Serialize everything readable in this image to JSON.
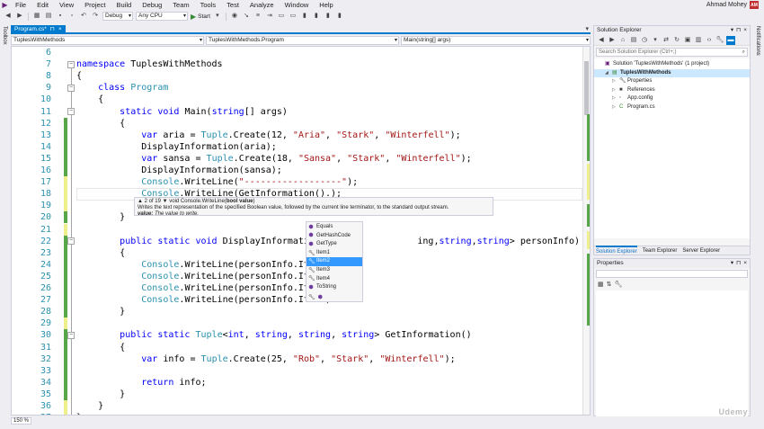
{
  "menu": {
    "items": [
      "File",
      "Edit",
      "View",
      "Project",
      "Build",
      "Debug",
      "Team",
      "Tools",
      "Test",
      "Analyze",
      "Window",
      "Help"
    ],
    "account_name": "Ahmad Mohey",
    "avatar_initials": "AM"
  },
  "toolbar": {
    "config": "Debug",
    "platform": "Any CPU",
    "start_label": "Start"
  },
  "side_rails": {
    "left": "Toolbox",
    "right": "Notifications"
  },
  "tabs": {
    "active": "Program.cs*",
    "pin": "⊓",
    "close": "×"
  },
  "nav": {
    "project": "TuplesWithMethods",
    "class": "TuplesWithMethods.Program",
    "member": "Main(string[] args)"
  },
  "code_lines": [
    {
      "n": "6",
      "text": ""
    },
    {
      "n": "7",
      "text": "namespace TuplesWithMethods"
    },
    {
      "n": "8",
      "text": "{"
    },
    {
      "n": "9",
      "text": "    class Program"
    },
    {
      "n": "10",
      "text": "    {"
    },
    {
      "n": "11",
      "text": "        static void Main(string[] args)"
    },
    {
      "n": "12",
      "text": "        {"
    },
    {
      "n": "13",
      "text": "            var aria = Tuple.Create(12, \"Aria\", \"Stark\", \"Winterfell\");"
    },
    {
      "n": "14",
      "text": "            DisplayInformation(aria);"
    },
    {
      "n": "15",
      "text": "            var sansa = Tuple.Create(18, \"Sansa\", \"Stark\", \"Winterfell\");"
    },
    {
      "n": "16",
      "text": "            DisplayInformation(sansa);"
    },
    {
      "n": "17",
      "text": "            Console.WriteLine(\"------------------\");"
    },
    {
      "n": "18",
      "text": "            Console.WriteLine(GetInformation().);"
    },
    {
      "n": "19",
      "text": ""
    },
    {
      "n": "20",
      "text": "        }"
    },
    {
      "n": "21",
      "text": ""
    },
    {
      "n": "22",
      "text": "        public static void DisplayInformation(T                ing,string,string> personInfo)"
    },
    {
      "n": "23",
      "text": "        {"
    },
    {
      "n": "24",
      "text": "            Console.WriteLine(personInfo.Item1)"
    },
    {
      "n": "25",
      "text": "            Console.WriteLine(personInfo.Item2)"
    },
    {
      "n": "26",
      "text": "            Console.WriteLine(personInfo.Item3)"
    },
    {
      "n": "27",
      "text": "            Console.WriteLine(personInfo.Item4)"
    },
    {
      "n": "28",
      "text": "        }"
    },
    {
      "n": "29",
      "text": ""
    },
    {
      "n": "30",
      "text": "        public static Tuple<int, string, string, string> GetInformation()"
    },
    {
      "n": "31",
      "text": "        {"
    },
    {
      "n": "32",
      "text": "            var info = Tuple.Create(25, \"Rob\", \"Stark\", \"Winterfell\");"
    },
    {
      "n": "33",
      "text": ""
    },
    {
      "n": "34",
      "text": "            return info;"
    },
    {
      "n": "35",
      "text": "        }"
    },
    {
      "n": "36",
      "text": "    }"
    },
    {
      "n": "37",
      "text": "}"
    }
  ],
  "tooltip": {
    "counter": "▲ 2 of 19 ▼",
    "signature_prefix": "void Console.WriteLine(",
    "signature_param": "bool value",
    "signature_suffix": ")",
    "description": "Writes the text representation of the specified Boolean value, followed by the current line terminator, to the standard output stream.",
    "param_name": "value:",
    "param_desc": "The value to write."
  },
  "completion": {
    "items": [
      {
        "label": "Equals",
        "icon": "method-icon"
      },
      {
        "label": "GetHashCode",
        "icon": "method-icon"
      },
      {
        "label": "GetType",
        "icon": "method-icon"
      },
      {
        "label": "Item1",
        "icon": "property-icon"
      },
      {
        "label": "Item2",
        "icon": "property-icon",
        "selected": true
      },
      {
        "label": "Item3",
        "icon": "property-icon"
      },
      {
        "label": "Item4",
        "icon": "property-icon"
      },
      {
        "label": "ToString",
        "icon": "method-icon"
      }
    ]
  },
  "status": {
    "zoom": "150 %"
  },
  "solution_explorer": {
    "title": "Solution Explorer",
    "search_placeholder": "Search Solution Explorer (Ctrl+;)",
    "tree": [
      {
        "label": "Solution 'TuplesWithMethods' (1 project)",
        "indent": 0,
        "icon": "solution-icon"
      },
      {
        "label": "TuplesWithMethods",
        "indent": 1,
        "icon": "project-icon",
        "selected": true,
        "bold": true
      },
      {
        "label": "Properties",
        "indent": 2,
        "icon": "wrench-icon"
      },
      {
        "label": "References",
        "indent": 2,
        "icon": "references-icon"
      },
      {
        "label": "App.config",
        "indent": 2,
        "icon": "config-icon"
      },
      {
        "label": "Program.cs",
        "indent": 2,
        "icon": "csharp-file-icon"
      }
    ],
    "tabs": [
      "Solution Explorer",
      "Team Explorer",
      "Server Explorer"
    ]
  },
  "properties": {
    "title": "Properties"
  },
  "watermark": "Udemy",
  "colors": {
    "accent": "#007acc",
    "keyword": "#0000ff",
    "type": "#2b91af",
    "string": "#a31515",
    "changed_saved": "#57a64a",
    "changed_unsaved": "#efef8b"
  }
}
